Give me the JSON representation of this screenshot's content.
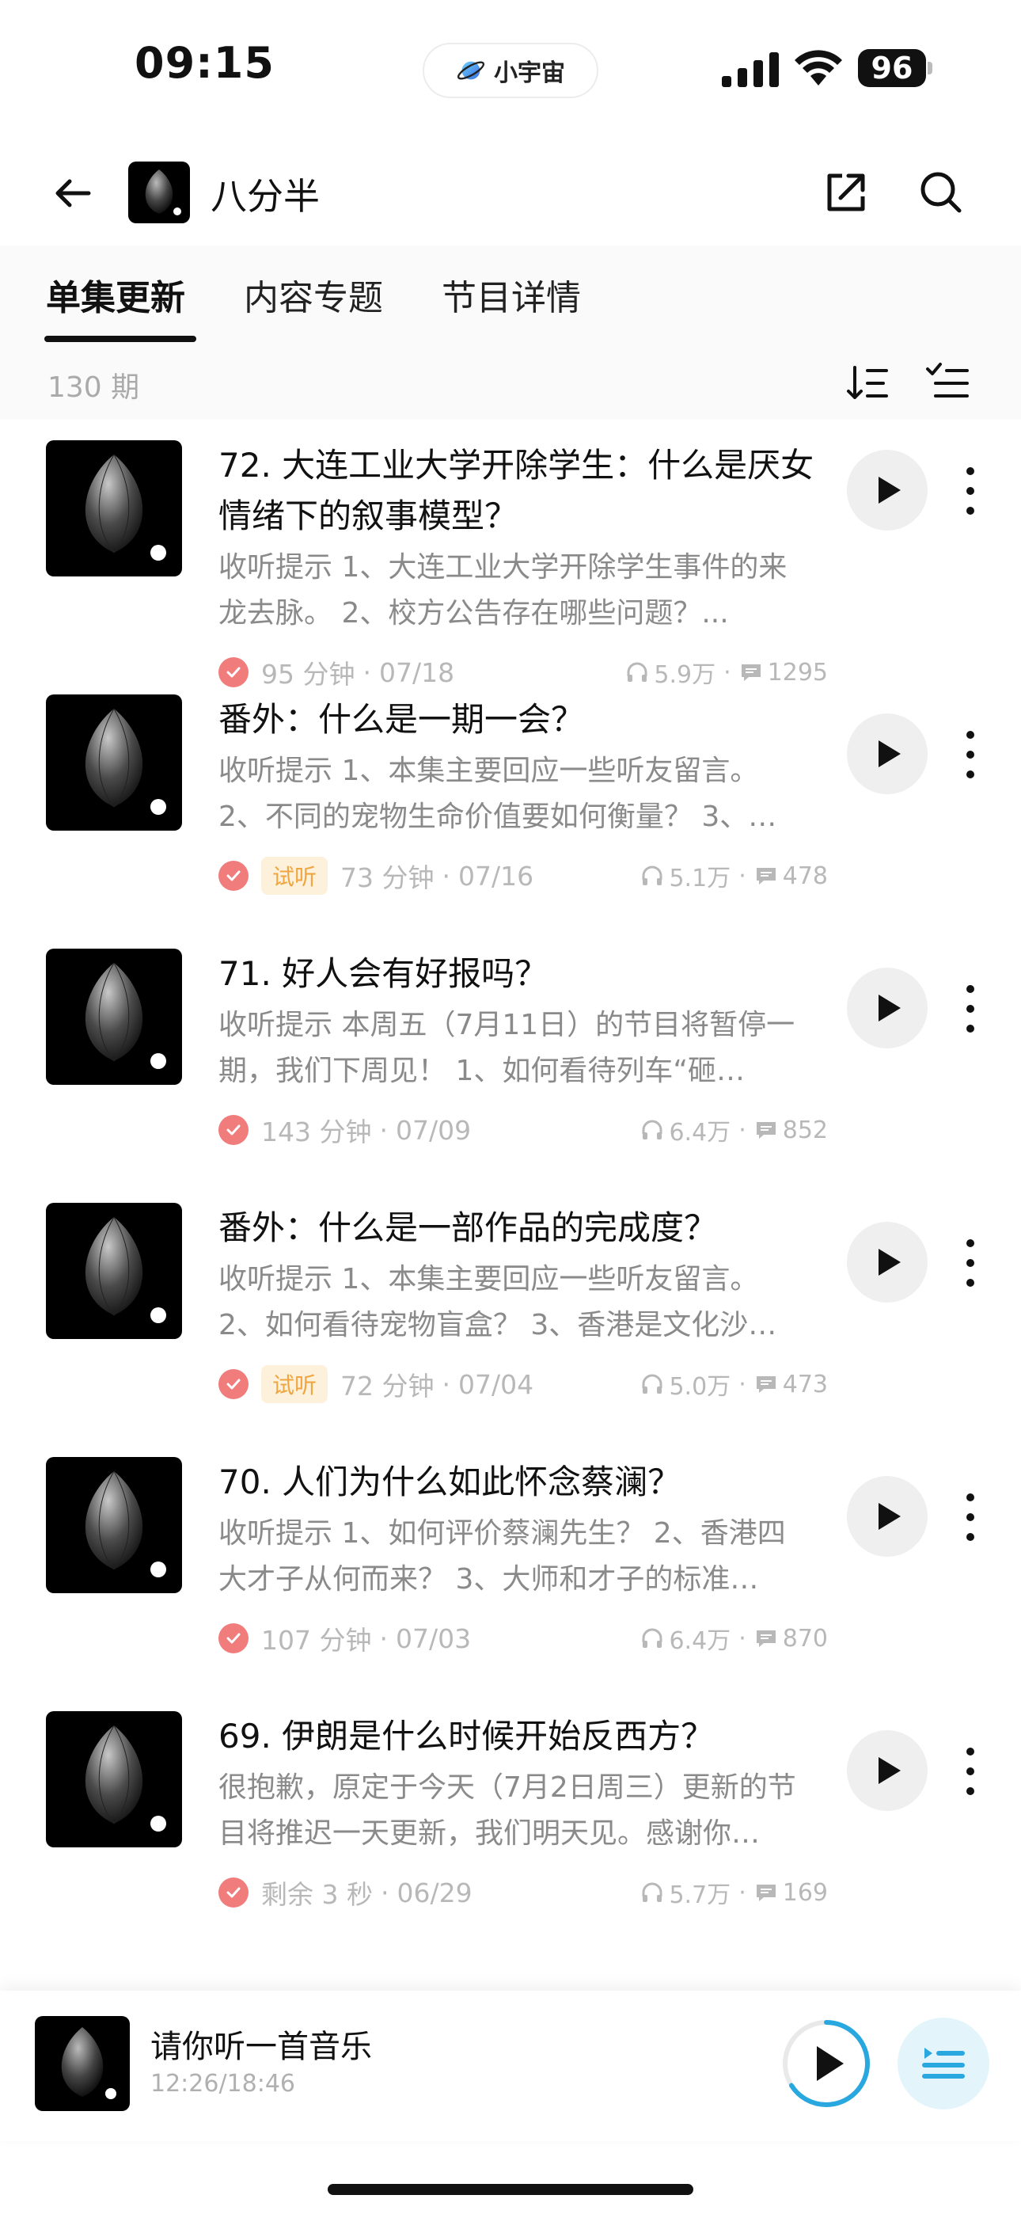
{
  "status_bar": {
    "time": "09:15",
    "island_label": "小宇宙",
    "battery": "96"
  },
  "nav": {
    "title": "八分半"
  },
  "tabs": [
    {
      "label": "单集更新",
      "active": true
    },
    {
      "label": "内容专题",
      "active": false
    },
    {
      "label": "节目详情",
      "active": false
    }
  ],
  "episode_count": "130 期",
  "episodes": [
    {
      "title": "72. 大连工业大学开除学生：什么是厌女情绪下的叙事模型？",
      "desc_line1": "收听提示 1、大连工业大学开除学生事件的来",
      "desc_line2": "龙去脉。 2、校方公告存在哪些问题？...",
      "trial": "",
      "duration": "95 分钟",
      "date": "07/18",
      "plays": "5.9万",
      "comments": "1295"
    },
    {
      "title": "番外：什么是一期一会？",
      "desc_line1": "收听提示 1、本集主要回应一些听友留言。",
      "desc_line2": "2、不同的宠物生命价值要如何衡量？ 3、…",
      "trial": "试听",
      "duration": "73 分钟",
      "date": "07/16",
      "plays": "5.1万",
      "comments": "478"
    },
    {
      "title": "71. 好人会有好报吗？",
      "desc_line1": "收听提示 本周五（7月11日）的节目将暂停一",
      "desc_line2": "期，我们下周见！ 1、如何看待列车“砸…",
      "trial": "",
      "duration": "143 分钟",
      "date": "07/09",
      "plays": "6.4万",
      "comments": "852"
    },
    {
      "title": "番外：什么是一部作品的完成度？",
      "desc_line1": "收听提示 1、本集主要回应一些听友留言。",
      "desc_line2": "2、如何看待宠物盲盒？ 3、香港是文化沙…",
      "trial": "试听",
      "duration": "72 分钟",
      "date": "07/04",
      "plays": "5.0万",
      "comments": "473"
    },
    {
      "title": "70. 人们为什么如此怀念蔡澜？",
      "desc_line1": "收听提示 1、如何评价蔡澜先生？ 2、香港四",
      "desc_line2": "大才子从何而来？ 3、大师和才子的标准…",
      "trial": "",
      "duration": "107 分钟",
      "date": "07/03",
      "plays": "6.4万",
      "comments": "870"
    },
    {
      "title": "69. 伊朗是什么时候开始反西方？",
      "desc_line1": "很抱歉，原定于今天（7月2日周三）更新的节",
      "desc_line2": "目将推迟一天更新，我们明天见。感谢你…",
      "trial": "",
      "duration": "剩余 3 秒",
      "date": "06/29",
      "plays": "5.7万",
      "comments": "169"
    }
  ],
  "mini_player": {
    "title": "请你听一首音乐",
    "time": "12:26/18:46",
    "progress": 0.66
  },
  "colors": {
    "accent_blue": "#29a8e0",
    "check_red": "#f07c7c",
    "trial_orange": "#f0a640"
  }
}
